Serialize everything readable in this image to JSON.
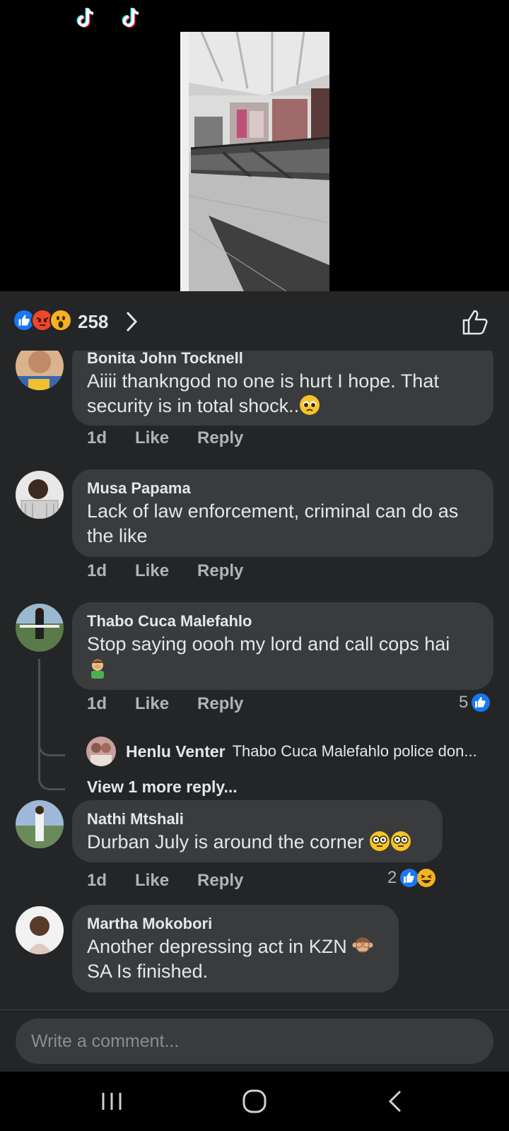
{
  "reactions": {
    "count": "258",
    "icons": [
      "like-icon",
      "angry-icon",
      "wow-icon"
    ]
  },
  "comments": [
    {
      "name": "Bonita John Tocknell",
      "text_line1": "Aiiii thankngod no one is hurt  I hope. That",
      "text_line2": "security is in total shock..",
      "emoji": "pleading-face-icon",
      "time": "1d",
      "like": "Like",
      "reply": "Reply"
    },
    {
      "name": "Musa Papama",
      "text_line1": "Lack of law enforcement, criminal can do as",
      "text_line2": "the like",
      "time": "1d",
      "like": "Like",
      "reply": "Reply"
    },
    {
      "name": "Thabo Cuca Malefahlo",
      "text_line1": "Stop saying oooh my lord and call cops hai",
      "emoji": "facepalm-icon",
      "time": "1d",
      "like": "Like",
      "reply": "Reply",
      "reaction_count": "5",
      "reply_preview": {
        "name": "Henlu Venter",
        "snippet": "Thabo Cuca Malefahlo police don..."
      },
      "view_more": "View 1 more reply..."
    },
    {
      "name": "Nathi Mtshali",
      "text_line1": "Durban July is around the corner",
      "emoji": "flushed-face-icon",
      "time": "1d",
      "like": "Like",
      "reply": "Reply",
      "reaction_count": "2"
    },
    {
      "name": "Martha Mokobori",
      "text_line1": "Another depressing act in KZN",
      "text_line2": "SA Is finished.",
      "emoji": "see-no-evil-monkey-icon"
    }
  ],
  "composer": {
    "placeholder": "Write a comment..."
  },
  "colors": {
    "background": "#242526",
    "bubble": "#3a3b3c",
    "like_blue": "#1877f2",
    "text": "#e4e6eb",
    "muted": "#b0b3b8"
  }
}
